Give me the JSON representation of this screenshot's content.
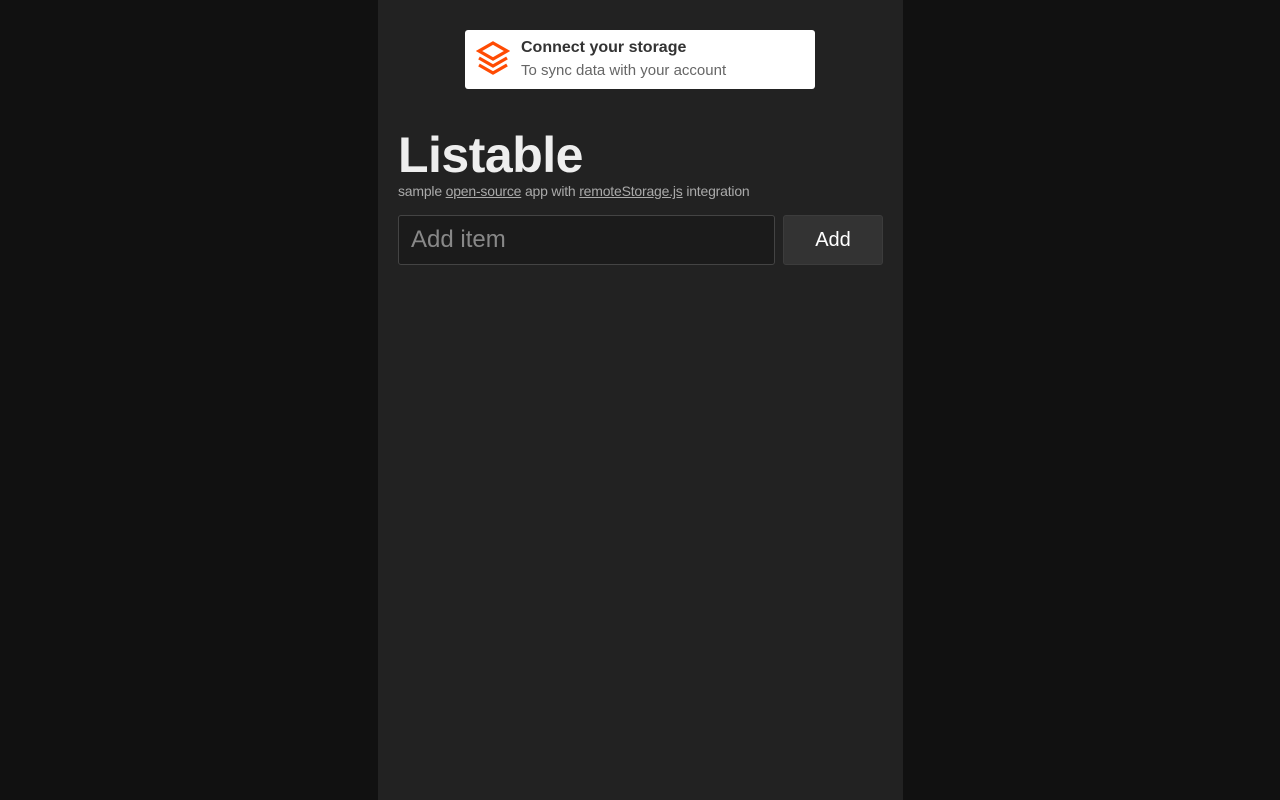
{
  "remote_storage": {
    "title": "Connect your storage",
    "subtitle": "To sync data with your account",
    "logo_icon": "remotestorage-logo-icon",
    "accent_color": "#ff4b03"
  },
  "header": {
    "title": "Listable",
    "tagline_prefix": "sample ",
    "link_open_source": "open-source",
    "tagline_middle": " app with ",
    "link_remotestorage": "remoteStorage.js",
    "tagline_suffix": " integration"
  },
  "add_form": {
    "input_value": "",
    "input_placeholder": "Add item",
    "button_label": "Add"
  },
  "items": []
}
